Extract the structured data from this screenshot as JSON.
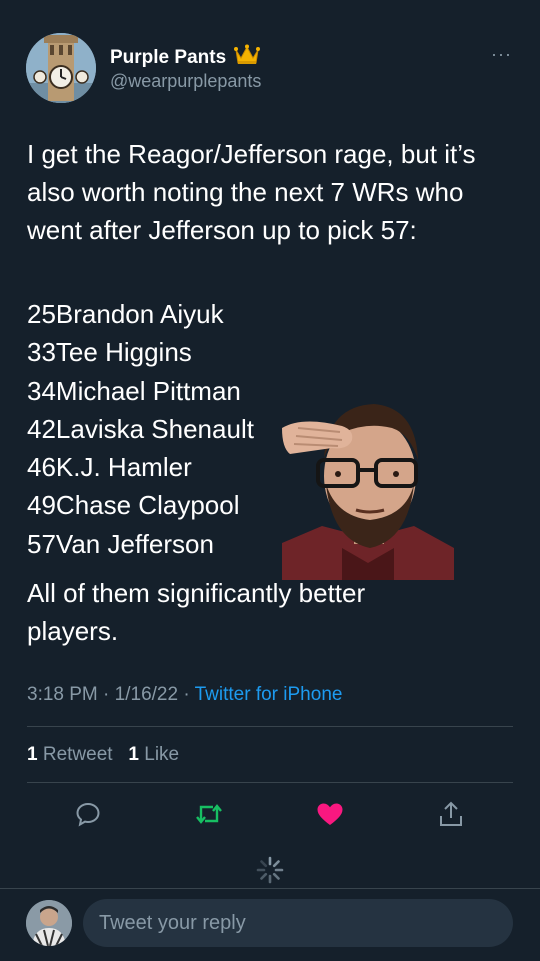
{
  "author": {
    "display_name": "Purple Pants",
    "handle": "@wearpurplepants",
    "badge_icon": "crown-icon",
    "more_label": "···"
  },
  "tweet": {
    "text": "I get the Reagor/Jefferson rage, but it’s also worth noting the next 7 WRs who went after Jefferson up to pick 57:",
    "picks": [
      "25Brandon Aiyuk",
      "33Tee Higgins",
      "34Michael Pittman",
      "42Laviska Shenault",
      "46K.J. Hamler",
      "49Chase Claypool",
      "57Van Jefferson"
    ],
    "closing": "All of them significantly better players."
  },
  "meta": {
    "time": "3:18 PM",
    "date": "1/16/22",
    "separator": "·",
    "source": "Twitter for iPhone"
  },
  "stats": {
    "retweet_count": "1",
    "retweet_label": "Retweet",
    "like_count": "1",
    "like_label": "Like"
  },
  "actions": [
    {
      "icon": "reply-icon",
      "color": "#8899a6"
    },
    {
      "icon": "retweet-icon",
      "color": "#17bf63"
    },
    {
      "icon": "heart-icon",
      "color": "#f91880"
    },
    {
      "icon": "share-icon",
      "color": "#8899a6"
    }
  ],
  "reply": {
    "placeholder": "Tweet your reply"
  },
  "colors": {
    "background": "#15202b",
    "secondary_text": "#8899a6",
    "link": "#1d9bf0",
    "retweet_active": "#17bf63",
    "like_active": "#f91880"
  }
}
